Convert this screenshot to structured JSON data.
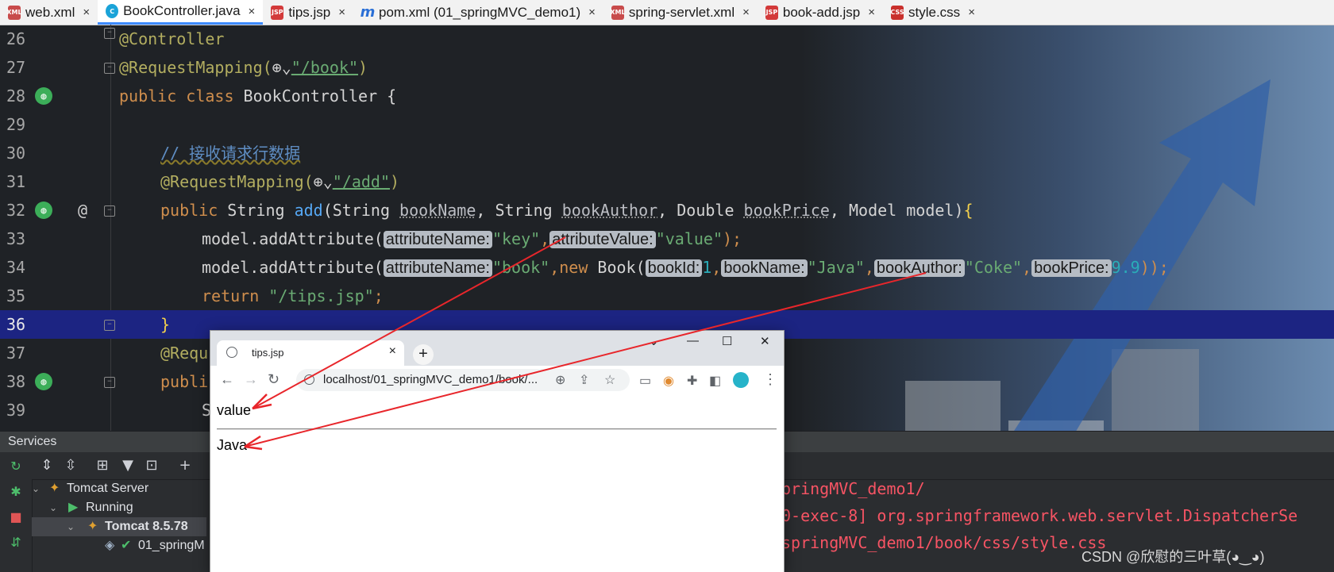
{
  "tabs": [
    {
      "label": "web.xml",
      "icon": "xml",
      "active": false
    },
    {
      "label": "BookController.java",
      "icon": "java",
      "active": true
    },
    {
      "label": "tips.jsp",
      "icon": "jsp",
      "active": false
    },
    {
      "label": "pom.xml (01_springMVC_demo1)",
      "icon": "maven",
      "active": false
    },
    {
      "label": "spring-servlet.xml",
      "icon": "xml",
      "active": false
    },
    {
      "label": "book-add.jsp",
      "icon": "jsp",
      "active": false
    },
    {
      "label": "style.css",
      "icon": "css",
      "active": false
    }
  ],
  "tab_close": "×",
  "icons": {
    "xml": "XML",
    "java": "C",
    "jsp": "JSP",
    "maven": "m",
    "css": "CSS"
  },
  "editor": {
    "line_numbers": [
      "26",
      "27",
      "28",
      "29",
      "30",
      "31",
      "32",
      "33",
      "34",
      "35",
      "36",
      "37",
      "38",
      "39"
    ],
    "highlighted_line": "36",
    "code": {
      "l26": "@Controller",
      "l27_ann": "@RequestMapping(",
      "l27_str": "\"/book\"",
      "l27_end": ")",
      "l28_kw": "public class ",
      "l28_rest": "BookController {",
      "l30_comment": "// 接收请求行数据",
      "l31_ann": "@RequestMapping(",
      "l31_str": "\"/add\"",
      "l31_end": ")",
      "l32_kw": "public ",
      "l32_type": "String ",
      "l32_fn": "add",
      "l32_p1": "(String ",
      "l32_p1n": "bookName",
      "l32_p2": ", String ",
      "l32_p2n": "bookAuthor",
      "l32_p3": ", Double ",
      "l32_p3n": "bookPrice",
      "l32_p4": ", Model model)",
      "l32_brace": "{",
      "l33_call": "model.addAttribute(",
      "l33_h1": "attributeName:",
      "l33_s1": "\"key\"",
      "l33_sep": ",",
      "l33_h2": "attributeValue:",
      "l33_s2": "\"value\"",
      "l33_end": ");",
      "l34_call": "model.addAttribute(",
      "l34_h1": "attributeName:",
      "l34_s1": "\"book\"",
      "l34_new": ",new ",
      "l34_book": "Book(",
      "l34_h2": "bookId:",
      "l34_n1": "1",
      "l34_h3": "bookName:",
      "l34_s2": "\"Java\"",
      "l34_h4": "bookAuthor:",
      "l34_s3": "\"Coke\"",
      "l34_h5": "bookPrice:",
      "l34_n2": "9.9",
      "l34_end": "));",
      "l35_kw": "return ",
      "l35_str": "\"/tips.jsp\"",
      "l35_end": ";",
      "l36": "}",
      "l37": "@Requ",
      "l38": "publi",
      "l39": "S",
      "at": "@"
    }
  },
  "services": {
    "title": "Services",
    "tree": [
      {
        "label": "Tomcat Server",
        "level": 1
      },
      {
        "label": "Running",
        "level": 2
      },
      {
        "label": "Tomcat 8.5.78",
        "level": 3,
        "selected": true
      },
      {
        "label": "01_springM",
        "level": 4
      }
    ],
    "log_lines": [
      "pringMVC_demo1/",
      "0-exec-8] org.springframework.web.servlet.DispatcherSe",
      "springMVC_demo1/book/css/style.css"
    ]
  },
  "browser": {
    "tab_title": "tips.jsp",
    "url": "localhost/01_springMVC_demo1/book/...",
    "content": {
      "line1": "value",
      "line2": "Java"
    },
    "accent_color": "#26b3c9"
  },
  "watermark": "CSDN @欣慰的三叶草(◕‿◕)",
  "colors": {
    "highlight_line": "#1c2482",
    "arrow": "#e8262b",
    "active_tab": "#3d8bff"
  }
}
